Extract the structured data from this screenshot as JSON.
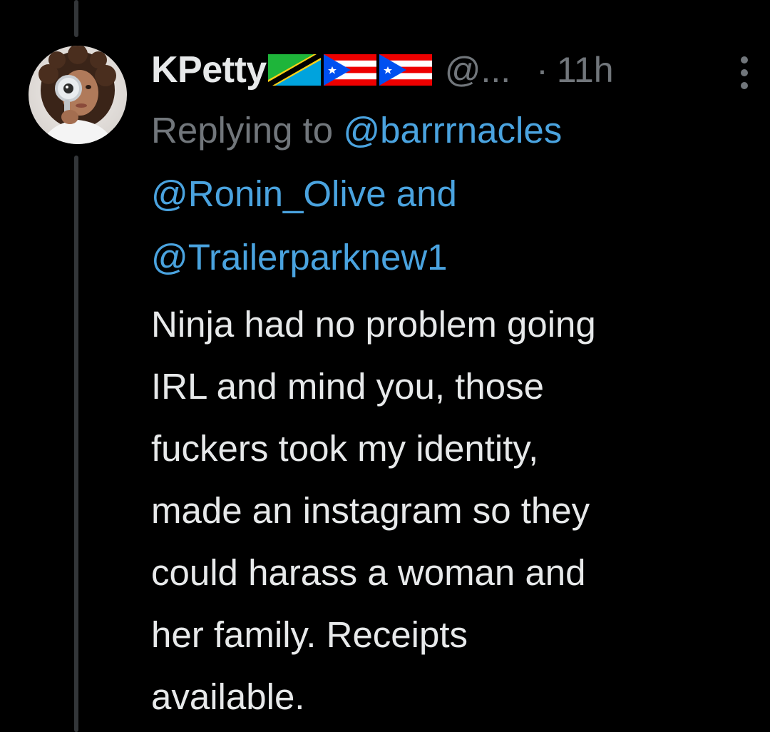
{
  "tweet": {
    "display_name": "KPetty",
    "flags": [
      "tanzania-flag",
      "puerto-rico-flag",
      "puerto-rico-flag"
    ],
    "handle": "@...",
    "separator": "·",
    "time": "11h",
    "replying_prefix": "Replying to",
    "mentions": [
      "@barrrnacles",
      "@Ronin_Olive",
      "@Trailerparknew1"
    ],
    "and_word": "and",
    "body_lines": [
      "Ninja had no problem going",
      "IRL and mind you, those",
      "fuckers took my identity,",
      "made an instagram so they",
      "could harass a woman and",
      "her family. Receipts",
      "available."
    ]
  },
  "colors": {
    "background": "#000000",
    "primary_text": "#e7e9ea",
    "secondary_text": "#71767b",
    "link": "#4aa3df",
    "thread_line": "#333639"
  },
  "icons": {
    "more": "more-vertical-icon",
    "avatar": "avatar-magnifying-glass"
  }
}
